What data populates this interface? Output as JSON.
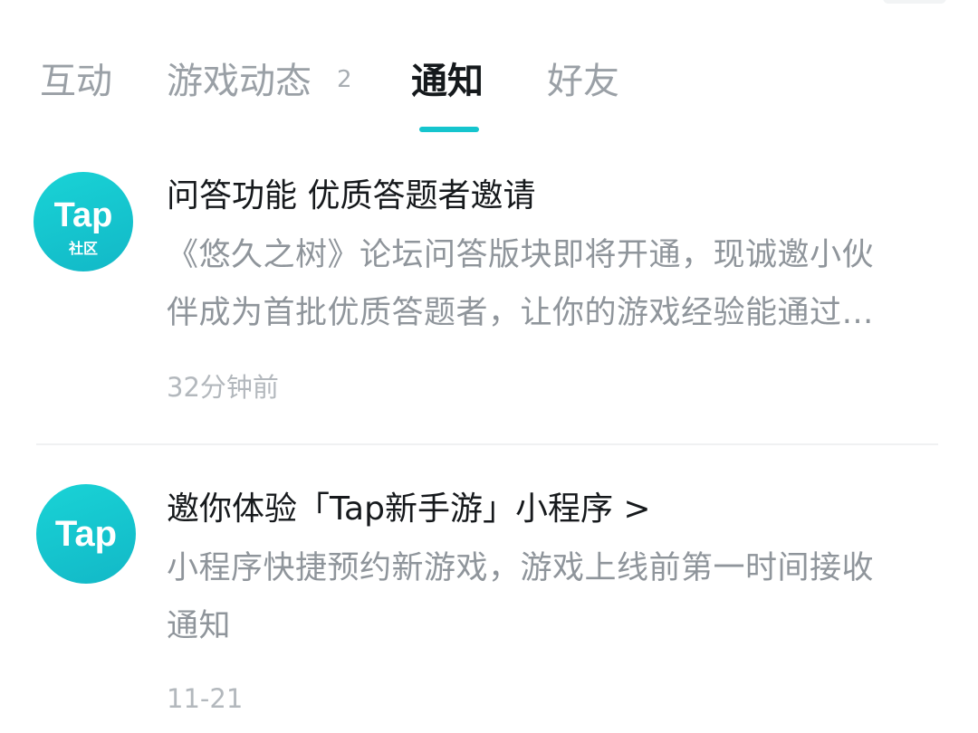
{
  "tabs": [
    {
      "label": "互动"
    },
    {
      "label": "游戏动态",
      "badge": "2"
    },
    {
      "label": "通知"
    },
    {
      "label": "好友"
    }
  ],
  "notifications": [
    {
      "avatar_text": "Tap",
      "avatar_subtext": "社区",
      "title": "问答功能 优质答题者邀请",
      "body_lines": [
        "《悠久之树》论坛问答版块即将开通，现诚邀小伙",
        "伴成为首批优质答题者，让你的游戏经验能通过…"
      ],
      "time": "32分钟前"
    },
    {
      "avatar_text": "Tap",
      "title": "邀你体验「Tap新手游」小程序 >",
      "body_lines": [
        "小程序快捷预约新游戏，游戏上线前第一时间接收",
        "通知"
      ],
      "time": "11-21"
    }
  ],
  "colors": {
    "accent": "#15c5ce",
    "tab_inactive": "#9aa0a6",
    "tab_active": "#15191c"
  }
}
